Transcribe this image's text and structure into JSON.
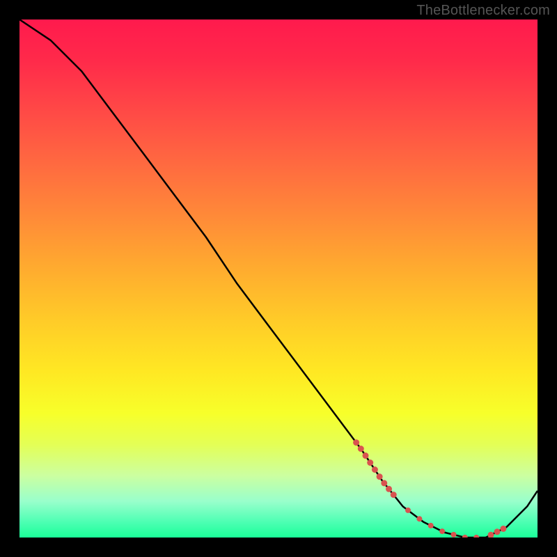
{
  "watermark": "TheBottlenecker.com",
  "chart_data": {
    "type": "line",
    "title": "",
    "xlabel": "",
    "ylabel": "",
    "xlim": [
      0,
      100
    ],
    "ylim": [
      0,
      100
    ],
    "series": [
      {
        "name": "curve",
        "x": [
          0,
          6,
          12,
          18,
          24,
          30,
          36,
          42,
          48,
          54,
          60,
          66,
          70,
          74,
          78,
          82,
          86,
          90,
          94,
          98,
          100
        ],
        "values": [
          100,
          96,
          90,
          82,
          74,
          66,
          58,
          49,
          41,
          33,
          25,
          17,
          11,
          6,
          3,
          1,
          0,
          0,
          2,
          6,
          9
        ]
      }
    ],
    "dotted_segment": {
      "x_start": 65,
      "x_end": 93
    },
    "background_gradient": {
      "top_color": "#ff1a4d",
      "mid_colors": [
        "#ff8a38",
        "#ffe823"
      ],
      "bottom_color": "#1aff99"
    }
  }
}
